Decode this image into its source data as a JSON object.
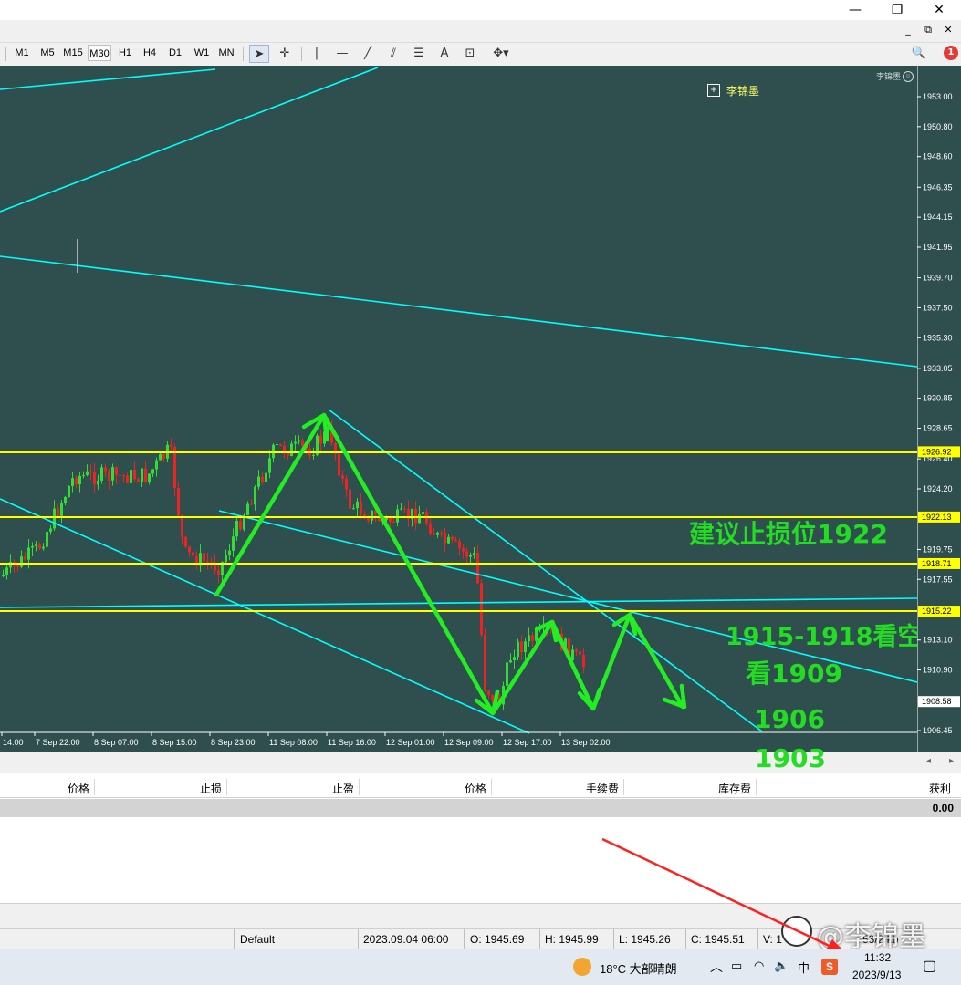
{
  "window": {
    "minimize_glyph": "—",
    "restore_glyph": "❐",
    "close_glyph": "✕"
  },
  "inner_window": {
    "minimize_glyph": "_",
    "restore_glyph": "⧉",
    "close_glyph": "✕"
  },
  "timeframes": [
    "M1",
    "M5",
    "M15",
    "M30",
    "H1",
    "H4",
    "D1",
    "W1",
    "MN"
  ],
  "active_timeframe": "M30",
  "notifications": {
    "count": "1"
  },
  "chart": {
    "indicator_label": "李锦墨",
    "corner_label": "李锦墨",
    "bg_color": "#2f4f4f",
    "line_color": "#00ffff",
    "level_color": "#ffff00",
    "annotation_color": "#22dd22"
  },
  "annotations": {
    "stop_loss": "建议止损位1922",
    "short_zone": "1915-1918看空",
    "target1": "看1909",
    "target2": "1906",
    "target3": "1903"
  },
  "price_axis": {
    "ticks": [
      "1953.00",
      "1950.80",
      "1948.60",
      "1946.35",
      "1944.15",
      "1941.95",
      "1939.70",
      "1937.50",
      "1935.30",
      "1933.05",
      "1930.85",
      "1928.65",
      "1926.40",
      "1924.20",
      "1919.75",
      "1917.55",
      "1913.10",
      "1910.90",
      "1906.45"
    ],
    "highlighted": [
      "1926.92",
      "1922.13",
      "1918.71",
      "1915.22"
    ],
    "current": "1908.58"
  },
  "time_axis": [
    "14:00",
    "7 Sep 22:00",
    "8 Sep 07:00",
    "8 Sep 15:00",
    "8 Sep 23:00",
    "11 Sep 08:00",
    "11 Sep 16:00",
    "12 Sep 01:00",
    "12 Sep 09:00",
    "12 Sep 17:00",
    "13 Sep 02:00"
  ],
  "terminal": {
    "columns": [
      "价格",
      "止损",
      "止盈",
      "价格",
      "手续费",
      "库存费",
      "获利"
    ],
    "balance": "0.00"
  },
  "status": {
    "profile": "Default",
    "datetime": "2023.09.04 06:00",
    "open": "O: 1945.69",
    "high": "H: 1945.99",
    "low": "L: 1945.26",
    "close": "C: 1945.51",
    "volume": "V: 1",
    "traffic": "53/2 kb"
  },
  "taskbar": {
    "weather": "18°C 大部晴朗",
    "ime": "中",
    "time": "11:32",
    "date": "2023/9/13"
  },
  "watermark": "@李锦墨"
}
